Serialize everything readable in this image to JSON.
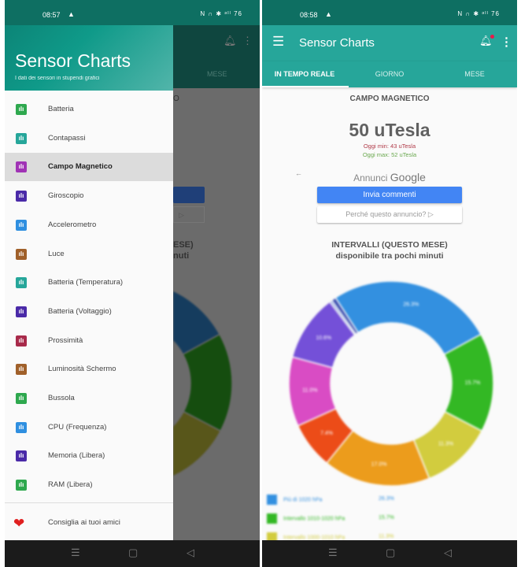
{
  "left_phone": {
    "status": {
      "time": "08:57",
      "icons": "N ∩ ✱ ᵊᴵˡ 76"
    },
    "drawer": {
      "title": "Sensor Charts",
      "subtitle": "I dati dei sensori in stupendi grafici",
      "items": [
        {
          "label": "Batteria",
          "color": "#2ea84e"
        },
        {
          "label": "Contapassi",
          "color": "#26a69a"
        },
        {
          "label": "Campo Magnetico",
          "color": "#a033b5",
          "selected": true
        },
        {
          "label": "Giroscopio",
          "color": "#4a2aa8"
        },
        {
          "label": "Accelerometro",
          "color": "#2f8fe0"
        },
        {
          "label": "Luce",
          "color": "#a0602a"
        },
        {
          "label": "Batteria (Temperatura)",
          "color": "#26a69a"
        },
        {
          "label": "Batteria (Voltaggio)",
          "color": "#4a2aa8"
        },
        {
          "label": "Prossimità",
          "color": "#a82a4a"
        },
        {
          "label": "Luminosità Schermo",
          "color": "#a0602a"
        },
        {
          "label": "Bussola",
          "color": "#2ea84e"
        },
        {
          "label": "CPU (Frequenza)",
          "color": "#2f8fe0"
        },
        {
          "label": "Memoria (Libera)",
          "color": "#4a2aa8"
        },
        {
          "label": "RAM (Libera)",
          "color": "#2ea84e"
        }
      ],
      "share_label": "Consiglia ai tuoi amici"
    },
    "behind": {
      "tab": "MESE",
      "title_fragment": "O",
      "heading_fragment": "ESE)",
      "sub_fragment": "nuti"
    }
  },
  "right_phone": {
    "status": {
      "time": "08:58",
      "icons": "N ∩ ✱ ᵊᴵˡ 76"
    },
    "toolbar": {
      "title": "Sensor Charts"
    },
    "tabs": [
      {
        "label": "IN TEMPO REALE",
        "active": true
      },
      {
        "label": "GIORNO"
      },
      {
        "label": "MESE"
      }
    ],
    "sensor": {
      "title": "CAMPO MAGNETICO",
      "value": "50 uTesla",
      "min": "Oggi min: 43 uTesla",
      "max": "Oggi max: 52 uTesla",
      "min_color": "#b03a48",
      "max_color": "#6aa84f"
    },
    "ad": {
      "label": "Annunci",
      "brand": "Google",
      "feedback": "Invia commenti",
      "why": "Perché questo annuncio? ▷"
    },
    "intervals": {
      "title": "INTERVALLI (QUESTO MESE)",
      "subtitle": "disponibile tra pochi minuti"
    }
  },
  "chart_data": {
    "type": "pie",
    "donut": true,
    "slices": [
      {
        "value": 26.3,
        "label": "26.3%",
        "color": "#3390e0"
      },
      {
        "value": 15.7,
        "label": "15.7%",
        "color": "#33b824"
      },
      {
        "value": 11.3,
        "label": "11.3%",
        "color": "#d2cc3e"
      },
      {
        "value": 17.0,
        "label": "17.0%",
        "color": "#ec9c1c"
      },
      {
        "value": 7.4,
        "label": "7.4%",
        "color": "#ec4c18"
      },
      {
        "value": 11.0,
        "label": "11.0%",
        "color": "#d94cc4"
      },
      {
        "value": 10.6,
        "label": "10.6%",
        "color": "#7450d8"
      },
      {
        "value": 0.4,
        "label": "",
        "color": "#8fa8e0"
      },
      {
        "value": 0.7,
        "label": "",
        "color": "#3c4fb0"
      }
    ],
    "legend": [
      {
        "label": "Più di 1020 hPa",
        "pct": "26.3%",
        "color": "#3390e0"
      },
      {
        "label": "Intervallo 1010-1020 hPa",
        "pct": "15.7%",
        "color": "#33b824"
      },
      {
        "label": "Intervallo 1000-1010 hPa",
        "pct": "11.3%",
        "color": "#d2cc3e"
      }
    ]
  }
}
